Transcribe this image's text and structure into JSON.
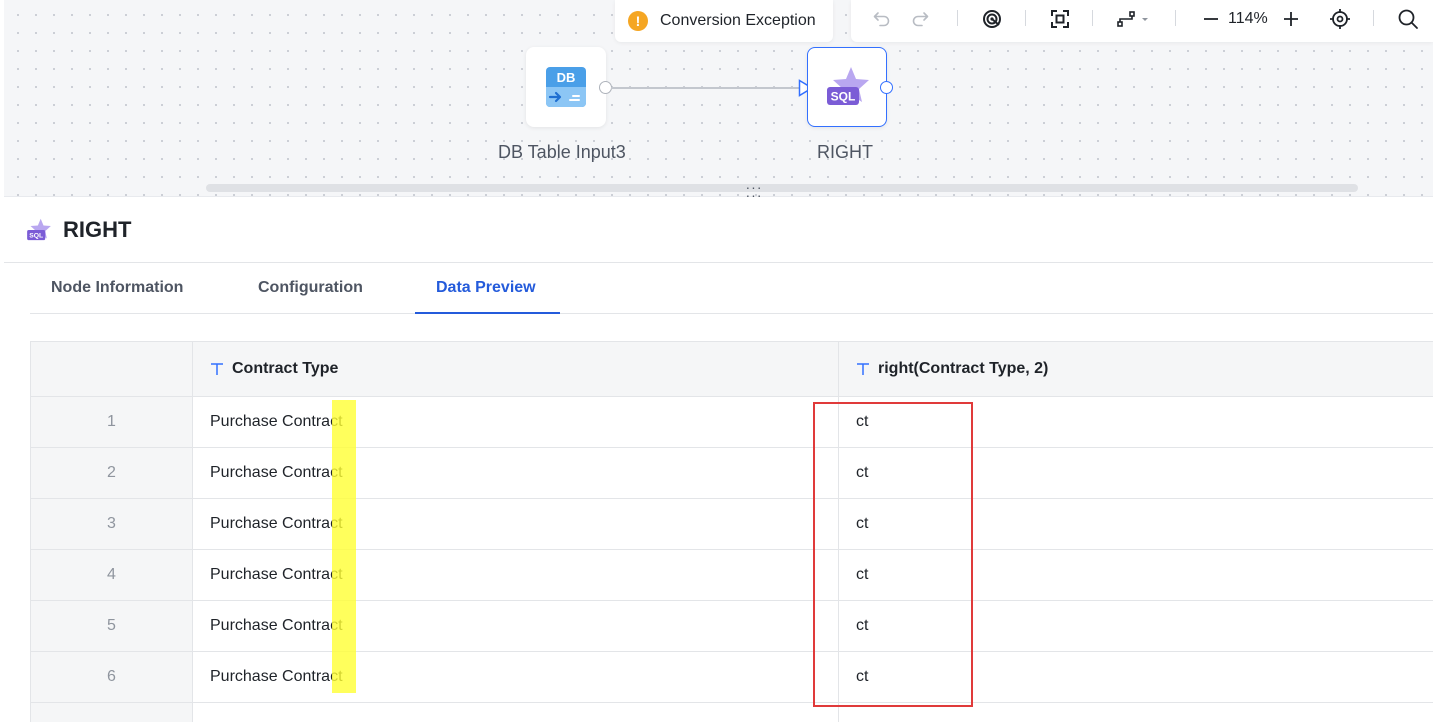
{
  "toolbar": {
    "exception_label": "Conversion Exception",
    "zoom_level": "114%",
    "icons": [
      "undo-icon",
      "redo-icon",
      "preview-icon",
      "fit-view-icon",
      "connector-style-icon",
      "zoom-out-icon",
      "zoom-in-icon",
      "locate-icon",
      "search-icon"
    ]
  },
  "canvas": {
    "nodes": [
      {
        "label": "DB Table Input3",
        "icon": "db-table-input-icon",
        "icon_text": "DB"
      },
      {
        "label": "RIGHT",
        "icon": "sql-function-icon",
        "icon_text": "SQL"
      }
    ]
  },
  "panel": {
    "title": "RIGHT",
    "icon_text": "SQL",
    "tabs": [
      {
        "label": "Node Information",
        "active": false
      },
      {
        "label": "Configuration",
        "active": false
      },
      {
        "label": "Data Preview",
        "active": true
      }
    ]
  },
  "table": {
    "columns": [
      "Contract Type",
      "right(Contract Type, 2)"
    ],
    "rows": [
      {
        "index": "1",
        "a": "Purchase Contract",
        "b": "ct"
      },
      {
        "index": "2",
        "a": "Purchase Contract",
        "b": "ct"
      },
      {
        "index": "3",
        "a": "Purchase Contract",
        "b": "ct"
      },
      {
        "index": "4",
        "a": "Purchase Contract",
        "b": "ct"
      },
      {
        "index": "5",
        "a": "Purchase Contract",
        "b": "ct"
      },
      {
        "index": "6",
        "a": "Purchase Contract",
        "b": "ct"
      }
    ]
  },
  "colors": {
    "accent": "#245bdb",
    "warning": "#f5a623",
    "highlight": "#ffff33",
    "annotation_box": "#e03a3a",
    "sql_purple": "#7b5cd6"
  }
}
